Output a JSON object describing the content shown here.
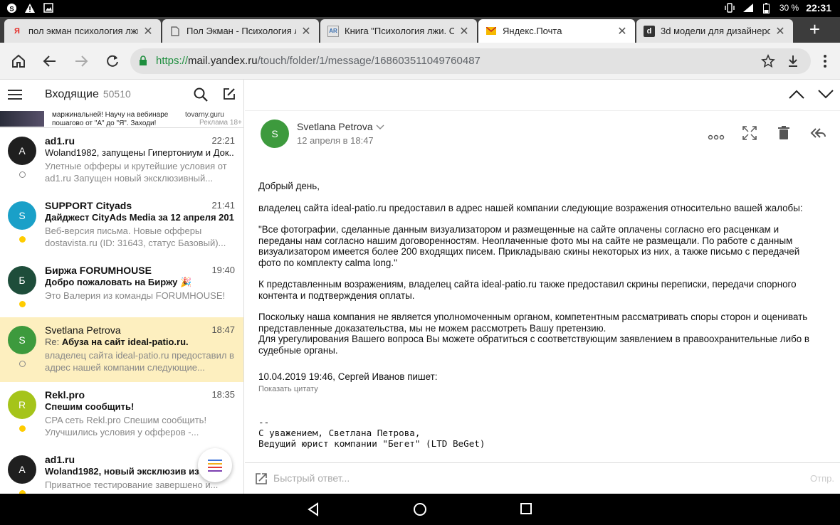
{
  "status_bar": {
    "battery": "30 %",
    "time": "22:31",
    "left_icons": [
      "skype-icon",
      "warning-icon",
      "image-icon"
    ],
    "right_icons": [
      "vibrate-icon",
      "signal-icon",
      "battery-icon"
    ]
  },
  "tabs": [
    {
      "favicon": "Я",
      "title": "пол экман психология лжи",
      "active": false
    },
    {
      "favicon": "doc",
      "title": "Пол Экман - Психология лж",
      "active": false
    },
    {
      "favicon": "AR",
      "title": "Книга \"Психология лжи. Об",
      "active": false
    },
    {
      "favicon": "mail",
      "title": "Яндекс.Почта",
      "active": true
    },
    {
      "favicon": "d",
      "title": "3d модели для дизайнеров",
      "active": false
    }
  ],
  "new_tab_label": "+",
  "url": {
    "protocol": "https://",
    "host": "mail.yandex.ru",
    "path": "/touch/folder/1/message/168603511049760487"
  },
  "left_panel": {
    "folder_name": "Входящие",
    "folder_count": "50510",
    "ad": {
      "text": "маржинальней! Научу на вебинаре пошагово от \"А\" до \"Я\". Заходи!",
      "source": "tovarny.guru",
      "mark": "Реклама  18+"
    },
    "messages": [
      {
        "avatar": "A",
        "avatar_color": "#1f1f1f",
        "from": "ad1.ru",
        "time": "22:21",
        "subject": "Woland1982, запущены Гипертониум и Док...",
        "preview": "Улетные офферы и крутейшие условия от ad1.ru Запущен новый эксклюзивный...",
        "unread": false,
        "selected": false
      },
      {
        "avatar": "S",
        "avatar_color": "#1aa0c8",
        "from": "SUPPORT Cityads",
        "time": "21:41",
        "subject": "Дайджест CityAds Media за 12 апреля 2019...",
        "preview": "Веб-версия письма. Новые офферы dostavista.ru (ID: 31643, статус Базовый)...",
        "unread": true,
        "selected": false
      },
      {
        "avatar": "Б",
        "avatar_color": "#1e4d3a",
        "from": "Биржа FORUMHOUSE",
        "time": "19:40",
        "subject": "Добро пожаловать на Биржу 🎉",
        "preview": "Это Валерия из команды FORUMHOUSE!",
        "unread": true,
        "selected": false
      },
      {
        "avatar": "S",
        "avatar_color": "#3d9a3d",
        "from": "Svetlana Petrova",
        "time": "18:47",
        "subject_prefix": "Re:",
        "subject": "Абуза на сайт ideal-patio.ru.",
        "preview": "владелец сайта ideal-patio.ru предоставил в адрес нашей компании следующие...",
        "unread": false,
        "selected": true
      },
      {
        "avatar": "R",
        "avatar_color": "#a5c41a",
        "from": "Rekl.pro",
        "time": "18:35",
        "subject": "Спешим сообщить!",
        "preview": "CPA сеть Rekl.pro Спешим сообщить! Улучшились условия у офферов -...",
        "unread": true,
        "selected": false
      },
      {
        "avatar": "A",
        "avatar_color": "#1f1f1f",
        "from": "ad1.ru",
        "time": "",
        "subject": "Woland1982, новый эксклюзив из п...",
        "preview": "Приватное тестирование завершено и...",
        "unread": true,
        "selected": false
      }
    ]
  },
  "message": {
    "sender_initial": "S",
    "sender": "Svetlana Petrova",
    "date": "12 апреля в 18:47",
    "body": [
      "Добрый день,",
      "владелец сайта ideal-patio.ru предоставил в адрес нашей компании следующие возражения относительно вашей жалобы:",
      "\"Все фотографии, сделанные данным визуализатором и размещенные на сайте оплачены согласно его расценкам и переданы нам согласно нашим договоренностям. Неоплаченные фото мы на сайте не размещали. По работе с данным визуализатором имеется более 200 входящих писем. Прикладываю скины некоторых из них, а также письмо с передачей фото по комплекту calma long.\"",
      "К представленным возражениям, владелец сайта ideal-patio.ru также предоставил скрины переписки, передачи спорного контента и подтверждения оплаты.",
      "Поскольку наша компания не является уполномоченным органом, компетентным рассматривать споры сторон и оценивать представленные доказательства, мы не можем рассмотреть Вашу претензию.\nДля урегулирования Вашего вопроса Вы можете обратиться с соответствующим заявлением в правоохранительные либо в судебные органы."
    ],
    "quote_header": "10.04.2019 19:46, Сергей Иванов пишет:",
    "show_quote": "Показать цитату",
    "signature": "--\nС уважением, Светлана Петрова,\nВедущий юрист компании \"Бегет\" (LTD BeGet)"
  },
  "reply": {
    "placeholder": "Быстрый ответ...",
    "send_label": "Отпр."
  }
}
